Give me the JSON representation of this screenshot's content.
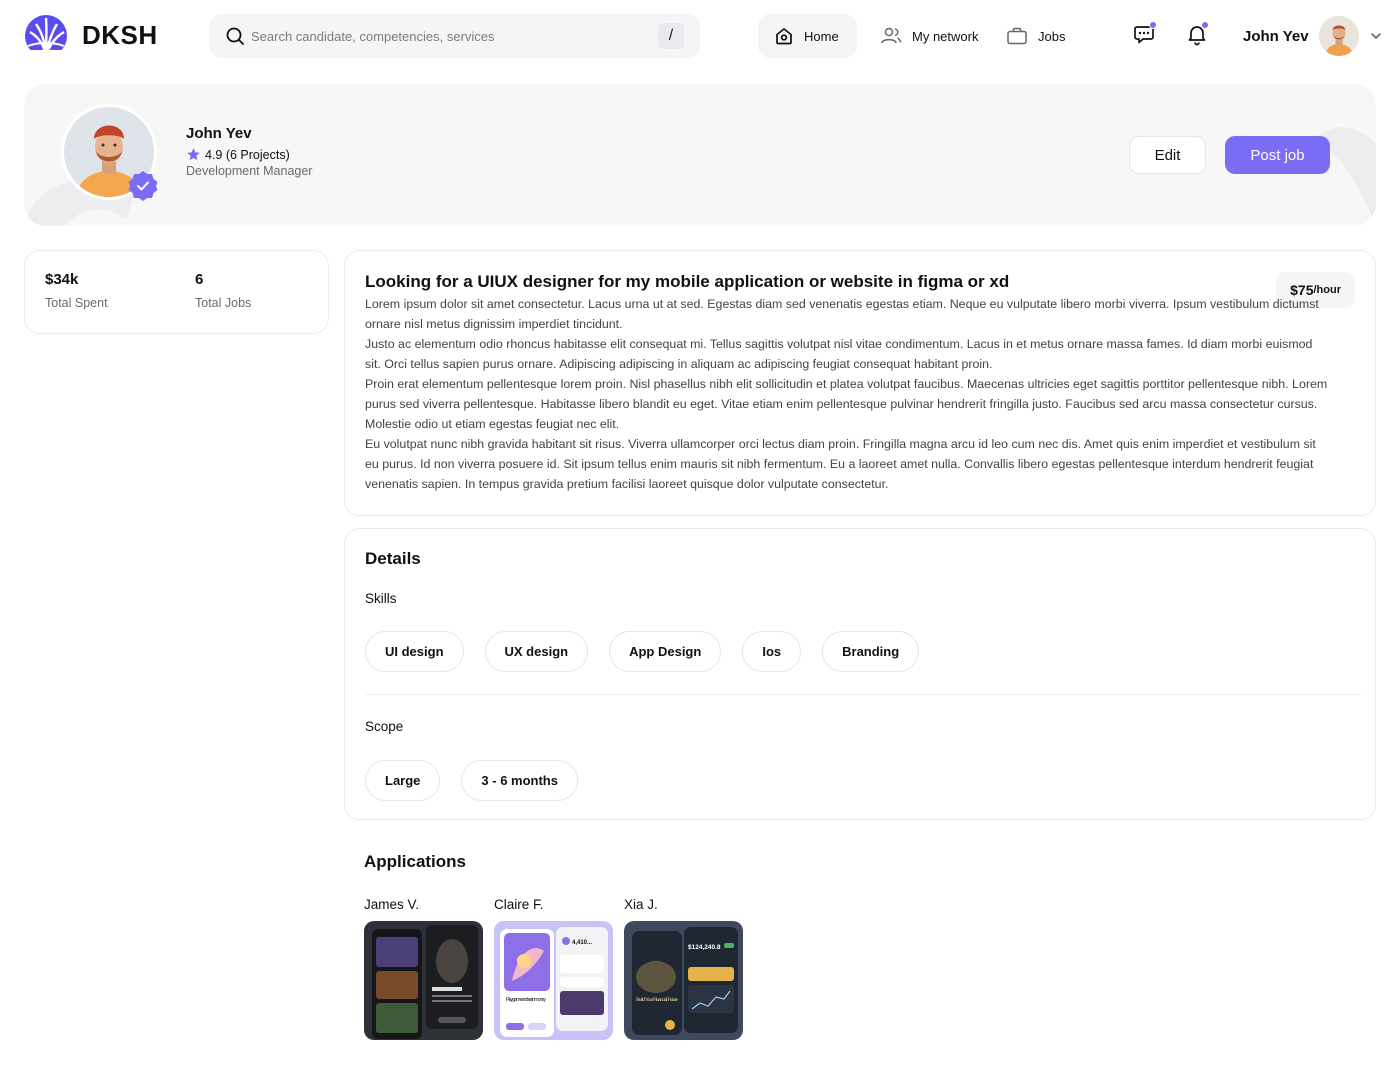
{
  "brand": {
    "name": "DKSH",
    "accent": "#7b6cf6",
    "logo_color": "#5b4cf0"
  },
  "search": {
    "placeholder": "Search candidate, competencies, services",
    "shortcut": "/"
  },
  "nav": {
    "home": {
      "label": "Home",
      "icon": "home-icon"
    },
    "network": {
      "label": "My network",
      "icon": "users-icon"
    },
    "jobs": {
      "label": "Jobs",
      "icon": "briefcase-icon"
    }
  },
  "header_user": {
    "name": "John Yev"
  },
  "profile": {
    "name": "John Yev",
    "rating": "4.9 (6 Projects)",
    "role": "Development Manager",
    "edit_label": "Edit",
    "post_label": "Post job"
  },
  "stats": {
    "spent_value": "$34k",
    "spent_label": "Total Spent",
    "jobs_value": "6",
    "jobs_label": "Total Jobs"
  },
  "job": {
    "title": "Looking for a UIUX designer for my mobile application or website in figma or xd",
    "rate_amount": "$75",
    "rate_unit": "/hour",
    "paragraphs": [
      "Lorem ipsum dolor sit amet consectetur. Lacus urna ut at sed. Egestas diam sed venenatis egestas etiam. Neque eu vulputate libero morbi viverra. Ipsum vestibulum dictumst ornare nisl metus dignissim imperdiet tincidunt.",
      "Justo ac elementum odio rhoncus habitasse elit consequat mi. Tellus sagittis volutpat nisl vitae condimentum. Lacus in et metus ornare massa fames. Id diam morbi euismod sit. Orci tellus sapien purus ornare. Adipiscing adipiscing in aliquam ac adipiscing feugiat consequat habitant proin.",
      "Proin erat elementum pellentesque lorem proin. Nisl phasellus nibh elit sollicitudin et platea volutpat faucibus. Maecenas ultricies eget sagittis porttitor pellentesque nibh. Lorem purus sed viverra pellentesque. Habitasse libero blandit eu eget. Vitae etiam enim pellentesque pulvinar hendrerit fringilla justo. Faucibus sed arcu massa consectetur cursus. Molestie odio ut etiam egestas feugiat nec elit.",
      "Eu volutpat nunc nibh gravida habitant sit risus. Viverra ullamcorper orci lectus diam proin. Fringilla magna arcu id leo cum nec dis. Amet quis enim imperdiet et vestibulum sit eu purus. Id non viverra posuere id. Sit ipsum tellus enim mauris sit nibh fermentum. Eu a laoreet amet nulla. Convallis libero egestas pellentesque interdum hendrerit feugiat venenatis sapien. In tempus gravida pretium facilisi laoreet quisque dolor vulputate consectetur."
    ]
  },
  "details": {
    "title": "Details",
    "skills_label": "Skills",
    "skills": [
      "UI design",
      "UX design",
      "App Design",
      "Ios",
      "Branding"
    ],
    "scope_label": "Scope",
    "scope": [
      "Large",
      "3 - 6 months"
    ]
  },
  "applications": {
    "title": "Applications",
    "items": [
      {
        "name": "James V."
      },
      {
        "name": "Claire F.",
        "thumb_text": "Play game and earn money",
        "thumb_value": "4,410..."
      },
      {
        "name": "Xia J.",
        "thumb_text": "Build Your Financial Future",
        "thumb_value": "$124,240.8"
      }
    ]
  }
}
